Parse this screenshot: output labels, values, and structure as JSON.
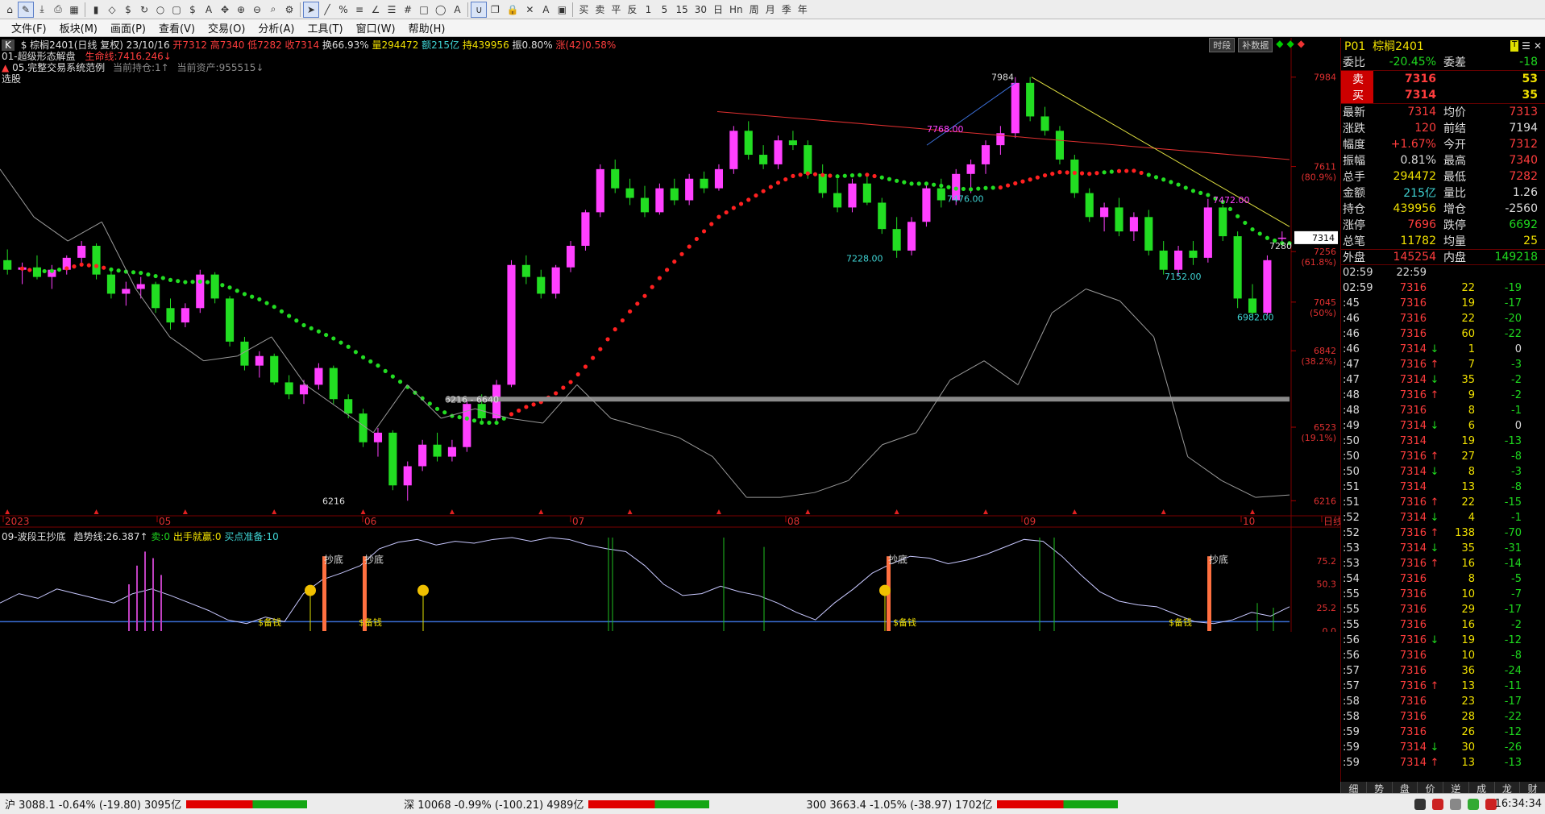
{
  "toolbar": {
    "icons": [
      "home-icon",
      "draw-icon",
      "download-icon",
      "print-icon",
      "grid-icon",
      "bars-icon",
      "diamond-icon",
      "dollar-icon",
      "refresh-icon",
      "circle-icon",
      "window-icon",
      "dollar-icon",
      "font-icon",
      "move-icon",
      "zoom-in-icon",
      "zoom-out-icon",
      "search-icon",
      "gear-icon",
      "cursor-icon",
      "line-icon",
      "percent-icon",
      "channel-icon",
      "angle-icon",
      "fib-icon",
      "grid2-icon",
      "rect-icon",
      "ellipse-icon",
      "text-icon",
      "magnet-icon",
      "copy-icon",
      "lock-icon",
      "delete-icon",
      "color-icon",
      "save-icon"
    ],
    "labels": [
      "买",
      "卖",
      "平",
      "反",
      "1",
      "5",
      "15",
      "30",
      "日",
      "Hn",
      "周",
      "月",
      "季",
      "年"
    ]
  },
  "menu": [
    "文件(F)",
    "板块(M)",
    "画面(P)",
    "查看(V)",
    "交易(O)",
    "分析(A)",
    "工具(T)",
    "窗口(W)",
    "帮助(H)"
  ],
  "header": {
    "line1": {
      "k_label": "K",
      "symbol": "$ 棕榈2401(日线 复权) 23/10/16",
      "open": "开7312",
      "high": "高7340",
      "low": "低7282",
      "close": "收7314",
      "turnover": "换66.93%",
      "volume": "量294472",
      "amount": "额215亿",
      "position": "持439956",
      "amplitude": "振0.80%",
      "change": "涨(42)0.58%"
    },
    "line2": {
      "name": "01-超级形态解盘",
      "value": "生命线:7416.246↓"
    },
    "line3": {
      "name": "05.完整交易系统范例",
      "pos": "当前持仓:1↑",
      "asset": "当前资产:955515↓"
    },
    "line4": "选股",
    "buttons": [
      "时段",
      "补数据"
    ]
  },
  "chart_data": {
    "type": "candlestick",
    "title": "棕榈2401(日线 复权)",
    "price_axis": [
      "7984",
      "7611",
      "7256",
      "7045",
      "6842",
      "6523",
      "6216"
    ],
    "price_axis_pct": [
      "(80.9%)",
      "(61.8%)",
      "(50%)",
      "(38.2%)",
      "(19.1%)"
    ],
    "ylim": [
      6180,
      8020
    ],
    "current_price_label": "7314",
    "date_axis": [
      "2023",
      "05",
      "06",
      "07",
      "08",
      "09",
      "10",
      "日线"
    ],
    "annotations": [
      "7768.00",
      "7984",
      "7476.00",
      "7472.00",
      "7228.00",
      "7152.00",
      "6982.00",
      "6216",
      "6216 - 6640",
      "7280"
    ],
    "candles": [
      {
        "o": 7220,
        "h": 7265,
        "l": 7160,
        "c": 7180
      },
      {
        "o": 7180,
        "h": 7210,
        "l": 7120,
        "c": 7190
      },
      {
        "o": 7190,
        "h": 7240,
        "l": 7140,
        "c": 7150
      },
      {
        "o": 7150,
        "h": 7200,
        "l": 7100,
        "c": 7180
      },
      {
        "o": 7180,
        "h": 7240,
        "l": 7160,
        "c": 7230
      },
      {
        "o": 7230,
        "h": 7300,
        "l": 7210,
        "c": 7280
      },
      {
        "o": 7280,
        "h": 7290,
        "l": 7140,
        "c": 7160
      },
      {
        "o": 7160,
        "h": 7180,
        "l": 7060,
        "c": 7080
      },
      {
        "o": 7080,
        "h": 7130,
        "l": 7030,
        "c": 7100
      },
      {
        "o": 7100,
        "h": 7150,
        "l": 7060,
        "c": 7120
      },
      {
        "o": 7120,
        "h": 7130,
        "l": 7000,
        "c": 7020
      },
      {
        "o": 7020,
        "h": 7060,
        "l": 6930,
        "c": 6960
      },
      {
        "o": 6960,
        "h": 7040,
        "l": 6940,
        "c": 7020
      },
      {
        "o": 7020,
        "h": 7180,
        "l": 7000,
        "c": 7160
      },
      {
        "o": 7160,
        "h": 7170,
        "l": 7040,
        "c": 7060
      },
      {
        "o": 7060,
        "h": 7070,
        "l": 6860,
        "c": 6880
      },
      {
        "o": 6880,
        "h": 6900,
        "l": 6760,
        "c": 6780
      },
      {
        "o": 6780,
        "h": 6840,
        "l": 6730,
        "c": 6820
      },
      {
        "o": 6820,
        "h": 6830,
        "l": 6700,
        "c": 6710
      },
      {
        "o": 6710,
        "h": 6740,
        "l": 6640,
        "c": 6660
      },
      {
        "o": 6660,
        "h": 6720,
        "l": 6620,
        "c": 6700
      },
      {
        "o": 6700,
        "h": 6790,
        "l": 6680,
        "c": 6770
      },
      {
        "o": 6770,
        "h": 6780,
        "l": 6620,
        "c": 6640
      },
      {
        "o": 6640,
        "h": 6660,
        "l": 6560,
        "c": 6580
      },
      {
        "o": 6580,
        "h": 6600,
        "l": 6440,
        "c": 6460
      },
      {
        "o": 6460,
        "h": 6520,
        "l": 6400,
        "c": 6500
      },
      {
        "o": 6500,
        "h": 6510,
        "l": 6260,
        "c": 6280
      },
      {
        "o": 6280,
        "h": 6380,
        "l": 6216,
        "c": 6360
      },
      {
        "o": 6360,
        "h": 6470,
        "l": 6340,
        "c": 6450
      },
      {
        "o": 6450,
        "h": 6500,
        "l": 6380,
        "c": 6400
      },
      {
        "o": 6400,
        "h": 6470,
        "l": 6380,
        "c": 6440
      },
      {
        "o": 6440,
        "h": 6640,
        "l": 6420,
        "c": 6620
      },
      {
        "o": 6620,
        "h": 6660,
        "l": 6540,
        "c": 6560
      },
      {
        "o": 6560,
        "h": 6720,
        "l": 6550,
        "c": 6700
      },
      {
        "o": 6700,
        "h": 7220,
        "l": 6690,
        "c": 7200
      },
      {
        "o": 7200,
        "h": 7240,
        "l": 7120,
        "c": 7150
      },
      {
        "o": 7150,
        "h": 7180,
        "l": 7060,
        "c": 7080
      },
      {
        "o": 7080,
        "h": 7200,
        "l": 7060,
        "c": 7190
      },
      {
        "o": 7190,
        "h": 7300,
        "l": 7170,
        "c": 7280
      },
      {
        "o": 7280,
        "h": 7430,
        "l": 7260,
        "c": 7420
      },
      {
        "o": 7420,
        "h": 7620,
        "l": 7400,
        "c": 7600
      },
      {
        "o": 7600,
        "h": 7640,
        "l": 7500,
        "c": 7520
      },
      {
        "o": 7520,
        "h": 7560,
        "l": 7450,
        "c": 7480
      },
      {
        "o": 7480,
        "h": 7530,
        "l": 7400,
        "c": 7420
      },
      {
        "o": 7420,
        "h": 7540,
        "l": 7410,
        "c": 7520
      },
      {
        "o": 7520,
        "h": 7560,
        "l": 7450,
        "c": 7470
      },
      {
        "o": 7470,
        "h": 7580,
        "l": 7450,
        "c": 7560
      },
      {
        "o": 7560,
        "h": 7590,
        "l": 7500,
        "c": 7520
      },
      {
        "o": 7520,
        "h": 7620,
        "l": 7510,
        "c": 7600
      },
      {
        "o": 7600,
        "h": 7780,
        "l": 7580,
        "c": 7760
      },
      {
        "o": 7760,
        "h": 7800,
        "l": 7640,
        "c": 7660
      },
      {
        "o": 7660,
        "h": 7700,
        "l": 7600,
        "c": 7620
      },
      {
        "o": 7620,
        "h": 7740,
        "l": 7600,
        "c": 7720
      },
      {
        "o": 7720,
        "h": 7760,
        "l": 7680,
        "c": 7700
      },
      {
        "o": 7700,
        "h": 7720,
        "l": 7560,
        "c": 7580
      },
      {
        "o": 7580,
        "h": 7620,
        "l": 7480,
        "c": 7500
      },
      {
        "o": 7500,
        "h": 7560,
        "l": 7420,
        "c": 7440
      },
      {
        "o": 7440,
        "h": 7560,
        "l": 7420,
        "c": 7540
      },
      {
        "o": 7540,
        "h": 7580,
        "l": 7450,
        "c": 7460
      },
      {
        "o": 7460,
        "h": 7480,
        "l": 7330,
        "c": 7350
      },
      {
        "o": 7350,
        "h": 7400,
        "l": 7230,
        "c": 7260
      },
      {
        "o": 7260,
        "h": 7400,
        "l": 7240,
        "c": 7380
      },
      {
        "o": 7380,
        "h": 7540,
        "l": 7360,
        "c": 7520
      },
      {
        "o": 7520,
        "h": 7560,
        "l": 7440,
        "c": 7470
      },
      {
        "o": 7470,
        "h": 7600,
        "l": 7450,
        "c": 7580
      },
      {
        "o": 7580,
        "h": 7640,
        "l": 7500,
        "c": 7620
      },
      {
        "o": 7620,
        "h": 7720,
        "l": 7580,
        "c": 7700
      },
      {
        "o": 7700,
        "h": 7780,
        "l": 7660,
        "c": 7750
      },
      {
        "o": 7750,
        "h": 7984,
        "l": 7730,
        "c": 7960
      },
      {
        "o": 7960,
        "h": 7984,
        "l": 7800,
        "c": 7820
      },
      {
        "o": 7820,
        "h": 7860,
        "l": 7740,
        "c": 7760
      },
      {
        "o": 7760,
        "h": 7780,
        "l": 7620,
        "c": 7640
      },
      {
        "o": 7640,
        "h": 7660,
        "l": 7480,
        "c": 7500
      },
      {
        "o": 7500,
        "h": 7520,
        "l": 7380,
        "c": 7400
      },
      {
        "o": 7400,
        "h": 7460,
        "l": 7340,
        "c": 7440
      },
      {
        "o": 7440,
        "h": 7480,
        "l": 7320,
        "c": 7340
      },
      {
        "o": 7340,
        "h": 7420,
        "l": 7300,
        "c": 7400
      },
      {
        "o": 7400,
        "h": 7430,
        "l": 7240,
        "c": 7260
      },
      {
        "o": 7260,
        "h": 7300,
        "l": 7160,
        "c": 7180
      },
      {
        "o": 7180,
        "h": 7280,
        "l": 7152,
        "c": 7260
      },
      {
        "o": 7260,
        "h": 7300,
        "l": 7200,
        "c": 7230
      },
      {
        "o": 7230,
        "h": 7476,
        "l": 7210,
        "c": 7440
      },
      {
        "o": 7440,
        "h": 7450,
        "l": 7300,
        "c": 7320
      },
      {
        "o": 7320,
        "h": 7340,
        "l": 7020,
        "c": 7060
      },
      {
        "o": 7060,
        "h": 7120,
        "l": 6982,
        "c": 7000
      },
      {
        "o": 7000,
        "h": 7240,
        "l": 6990,
        "c": 7220
      },
      {
        "o": 7312,
        "h": 7340,
        "l": 7282,
        "c": 7314
      }
    ],
    "overlays": [
      "生命线",
      "trend lines",
      "signal markers 多开/空损/空开/多赢/空赢"
    ],
    "sub_chart": {
      "title": "09-波段王抄底",
      "trend_label": "趋势线:26.387↑",
      "buy_label": "卖:0",
      "out_label": "出手就赢:0",
      "prep_label": "买点准备:10",
      "yaxis": [
        "75.2",
        "50.3",
        "25.2",
        "0.0"
      ],
      "signals": [
        "抄底",
        "抄底",
        "抄底",
        "抄底"
      ],
      "bottom_label": "$备钱"
    }
  },
  "quote": {
    "code": "P01",
    "name": "棕榈2401",
    "weibi_label": "委比",
    "weibi": "-20.45%",
    "weicha_label": "委差",
    "weicha": "-18",
    "sell_label": "卖",
    "sell_price": "7316",
    "sell_vol": "53",
    "buy_label": "买",
    "buy_price": "7314",
    "buy_vol": "35",
    "rows": [
      {
        "l1": "最新",
        "v1": "7314",
        "c1": "red",
        "l2": "均价",
        "v2": "7313",
        "c2": "red"
      },
      {
        "l1": "涨跌",
        "v1": "120",
        "c1": "red",
        "l2": "前结",
        "v2": "7194",
        "c2": "wht"
      },
      {
        "l1": "幅度",
        "v1": "+1.67%",
        "c1": "red",
        "l2": "今开",
        "v2": "7312",
        "c2": "red"
      },
      {
        "l1": "振幅",
        "v1": "0.81%",
        "c1": "wht",
        "l2": "最高",
        "v2": "7340",
        "c2": "red"
      },
      {
        "l1": "总手",
        "v1": "294472",
        "c1": "yel",
        "l2": "最低",
        "v2": "7282",
        "c2": "red"
      },
      {
        "l1": "金额",
        "v1": "215亿",
        "c1": "cy",
        "l2": "量比",
        "v2": "1.26",
        "c2": "wht"
      },
      {
        "l1": "持仓",
        "v1": "439956",
        "c1": "yel",
        "l2": "增仓",
        "v2": "-2560",
        "c2": "wht"
      },
      {
        "l1": "涨停",
        "v1": "7696",
        "c1": "red",
        "l2": "跌停",
        "v2": "6692",
        "c2": "grn"
      },
      {
        "l1": "总笔",
        "v1": "11782",
        "c1": "yel",
        "l2": "均量",
        "v2": "25",
        "c2": "yel"
      }
    ],
    "outer_label": "外盘",
    "outer": "145254",
    "inner_label": "内盘",
    "inner": "149218",
    "ticks": [
      {
        "t": "02:59",
        "p": "22:59",
        "a": "",
        "v": "",
        "c": ""
      },
      {
        "t": "02:59",
        "p": "7316",
        "a": "",
        "v": "22",
        "c": "-19"
      },
      {
        "t": ":45",
        "p": "7316",
        "a": "",
        "v": "19",
        "c": "-17"
      },
      {
        "t": ":46",
        "p": "7316",
        "a": "",
        "v": "22",
        "c": "-20"
      },
      {
        "t": ":46",
        "p": "7316",
        "a": "",
        "v": "60",
        "c": "-22"
      },
      {
        "t": ":46",
        "p": "7314",
        "a": "↓",
        "v": "1",
        "c": "0"
      },
      {
        "t": ":47",
        "p": "7316",
        "a": "↑",
        "v": "7",
        "c": "-3"
      },
      {
        "t": ":47",
        "p": "7314",
        "a": "↓",
        "v": "35",
        "c": "-2"
      },
      {
        "t": ":48",
        "p": "7316",
        "a": "↑",
        "v": "9",
        "c": "-2"
      },
      {
        "t": ":48",
        "p": "7316",
        "a": "",
        "v": "8",
        "c": "-1"
      },
      {
        "t": ":49",
        "p": "7314",
        "a": "↓",
        "v": "6",
        "c": "0"
      },
      {
        "t": ":50",
        "p": "7314",
        "a": "",
        "v": "19",
        "c": "-13"
      },
      {
        "t": ":50",
        "p": "7316",
        "a": "↑",
        "v": "27",
        "c": "-8"
      },
      {
        "t": ":50",
        "p": "7314",
        "a": "↓",
        "v": "8",
        "c": "-3"
      },
      {
        "t": ":51",
        "p": "7314",
        "a": "",
        "v": "13",
        "c": "-8"
      },
      {
        "t": ":51",
        "p": "7316",
        "a": "↑",
        "v": "22",
        "c": "-15"
      },
      {
        "t": ":52",
        "p": "7314",
        "a": "↓",
        "v": "4",
        "c": "-1"
      },
      {
        "t": ":52",
        "p": "7316",
        "a": "↑",
        "v": "138",
        "c": "-70"
      },
      {
        "t": ":53",
        "p": "7314",
        "a": "↓",
        "v": "35",
        "c": "-31"
      },
      {
        "t": ":53",
        "p": "7316",
        "a": "↑",
        "v": "16",
        "c": "-14"
      },
      {
        "t": ":54",
        "p": "7316",
        "a": "",
        "v": "8",
        "c": "-5"
      },
      {
        "t": ":55",
        "p": "7316",
        "a": "",
        "v": "10",
        "c": "-7"
      },
      {
        "t": ":55",
        "p": "7316",
        "a": "",
        "v": "29",
        "c": "-17"
      },
      {
        "t": ":55",
        "p": "7316",
        "a": "",
        "v": "16",
        "c": "-2"
      },
      {
        "t": ":56",
        "p": "7316",
        "a": "↓",
        "v": "19",
        "c": "-12"
      },
      {
        "t": ":56",
        "p": "7316",
        "a": "",
        "v": "10",
        "c": "-8"
      },
      {
        "t": ":57",
        "p": "7316",
        "a": "",
        "v": "36",
        "c": "-24"
      },
      {
        "t": ":57",
        "p": "7316",
        "a": "↑",
        "v": "13",
        "c": "-11"
      },
      {
        "t": ":58",
        "p": "7316",
        "a": "",
        "v": "23",
        "c": "-17"
      },
      {
        "t": ":58",
        "p": "7316",
        "a": "",
        "v": "28",
        "c": "-22"
      },
      {
        "t": ":59",
        "p": "7316",
        "a": "",
        "v": "26",
        "c": "-12"
      },
      {
        "t": ":59",
        "p": "7314",
        "a": "↓",
        "v": "30",
        "c": "-26"
      },
      {
        "t": ":59",
        "p": "7314",
        "a": "↑",
        "v": "13",
        "c": "-13"
      }
    ],
    "tabs": [
      "细",
      "势",
      "盘",
      "价",
      "逆",
      "成",
      "龙",
      "财"
    ]
  },
  "status": {
    "sh": "沪 3088.1 -0.64% (-19.80) 3095亿",
    "sz": "深 10068 -0.99% (-100.21) 4989亿",
    "i300": "300 3663.4 -1.05% (-38.97) 1702亿",
    "time": "16:34:34"
  },
  "colors": {
    "up": "#ff40ff",
    "down": "#22dd22",
    "ma_dots_up": "#ff2020",
    "ma_dots_down": "#22dd22"
  }
}
